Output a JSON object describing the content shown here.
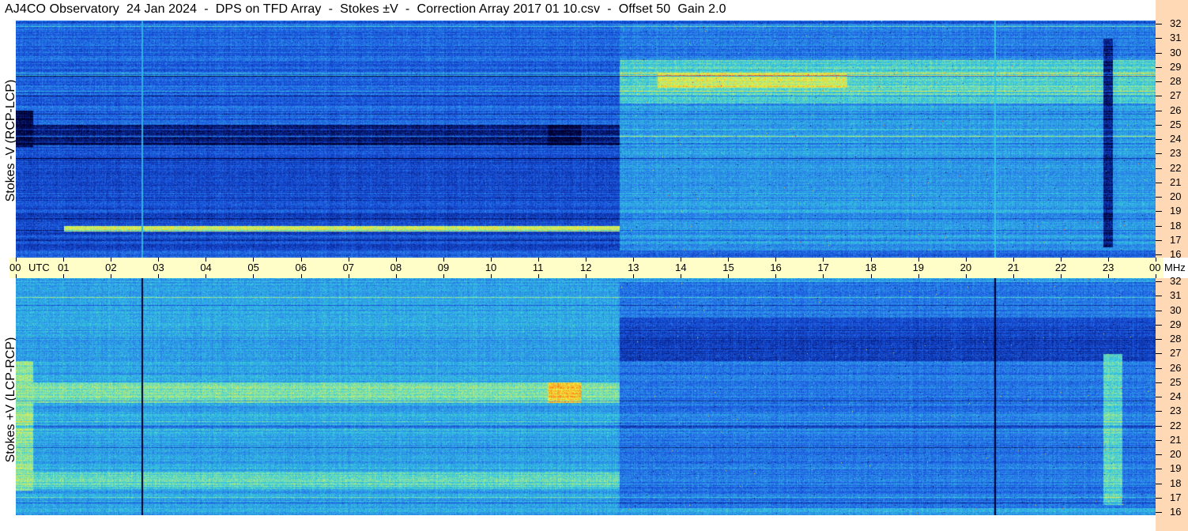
{
  "title": "AJ4CO Observatory  24 Jan 2024  -  DPS on TFD Array  -  Stokes ±V  -  Correction Array 2017 01 10.csv  -  Offset 50  Gain 2.0",
  "colors": {
    "time_axis_bg": "#fffdc8",
    "freq_axis_bg": "#ffd9b5",
    "colormap": [
      "#00002e",
      "#0a2a9c",
      "#1a55e0",
      "#2d8fe8",
      "#33c6e0",
      "#8ee6a0",
      "#f0ee3c",
      "#ff8a1a",
      "#e81c1c"
    ]
  },
  "chart_data": [
    {
      "type": "heatmap",
      "panel": "top",
      "ylabel": "Stokes -V (RCP-LCP)",
      "x_range_utc_hours": [
        0,
        24
      ],
      "y_range_mhz": [
        16,
        32
      ],
      "y_ticks": [
        "32",
        "31",
        "30",
        "29",
        "28",
        "27",
        "26",
        "25",
        "24",
        "23",
        "22",
        "21",
        "20",
        "19",
        "18",
        "17",
        "16"
      ],
      "base_level": 0.28,
      "regions": [
        {
          "t0": 0.0,
          "t1": 0.35,
          "f0": 23.0,
          "f1": 26.0,
          "level": 0.02
        },
        {
          "t0": 0.35,
          "t1": 12.7,
          "f0": 23.6,
          "f1": 25.0,
          "level": 0.08
        },
        {
          "t0": 11.2,
          "t1": 11.9,
          "f0": 23.6,
          "f1": 25.0,
          "level": 0.0
        },
        {
          "t0": 0.0,
          "t1": 12.7,
          "f0": 16.3,
          "f1": 23.5,
          "level": 0.22
        },
        {
          "t0": 1.0,
          "t1": 12.7,
          "f0": 17.6,
          "f1": 18.0,
          "level": 0.7
        },
        {
          "t0": 12.7,
          "t1": 24.0,
          "f0": 26.5,
          "f1": 29.5,
          "level": 0.55
        },
        {
          "t0": 13.5,
          "t1": 17.5,
          "f0": 27.6,
          "f1": 28.6,
          "level": 0.72
        },
        {
          "t0": 12.7,
          "t1": 24.0,
          "f0": 16.3,
          "f1": 26.5,
          "level": 0.4
        },
        {
          "t0": 12.7,
          "t1": 24.0,
          "f0": 29.5,
          "f1": 32.0,
          "level": 0.33
        },
        {
          "t0": 22.9,
          "t1": 23.1,
          "f0": 16.5,
          "f1": 31.0,
          "level": 0.1
        }
      ],
      "vlines": [
        {
          "t": 2.65,
          "level": 0.45
        },
        {
          "t": 20.6,
          "level": 0.5
        }
      ]
    },
    {
      "type": "heatmap",
      "panel": "bottom",
      "ylabel": "Stokes +V (LCP-RCP)",
      "x_range_utc_hours": [
        0,
        24
      ],
      "y_range_mhz": [
        16,
        32
      ],
      "y_ticks": [
        "32",
        "31",
        "30",
        "29",
        "28",
        "27",
        "26",
        "25",
        "24",
        "23",
        "22",
        "21",
        "20",
        "19",
        "18",
        "17",
        "16"
      ],
      "base_level": 0.42,
      "regions": [
        {
          "t0": 0.0,
          "t1": 0.35,
          "f0": 17.5,
          "f1": 26.5,
          "level": 0.62
        },
        {
          "t0": 0.35,
          "t1": 12.7,
          "f0": 23.6,
          "f1": 25.0,
          "level": 0.6
        },
        {
          "t0": 11.2,
          "t1": 11.9,
          "f0": 23.6,
          "f1": 25.0,
          "level": 0.8
        },
        {
          "t0": 0.35,
          "t1": 12.7,
          "f0": 17.6,
          "f1": 18.8,
          "level": 0.55
        },
        {
          "t0": 12.7,
          "t1": 24.0,
          "f0": 16.3,
          "f1": 32.0,
          "level": 0.32
        },
        {
          "t0": 12.7,
          "t1": 24.0,
          "f0": 26.5,
          "f1": 29.5,
          "level": 0.2
        },
        {
          "t0": 22.9,
          "t1": 23.3,
          "f0": 16.5,
          "f1": 27.0,
          "level": 0.55
        }
      ],
      "vlines": [
        {
          "t": 2.65,
          "level": 0.0
        },
        {
          "t": 20.6,
          "level": 0.0
        }
      ]
    }
  ],
  "time_axis": {
    "labels": [
      "00",
      "01",
      "02",
      "03",
      "04",
      "05",
      "06",
      "07",
      "08",
      "09",
      "10",
      "11",
      "12",
      "13",
      "14",
      "15",
      "16",
      "17",
      "18",
      "19",
      "20",
      "21",
      "22",
      "23",
      "00"
    ],
    "utc_label": "UTC",
    "unit_label": "MHz"
  }
}
